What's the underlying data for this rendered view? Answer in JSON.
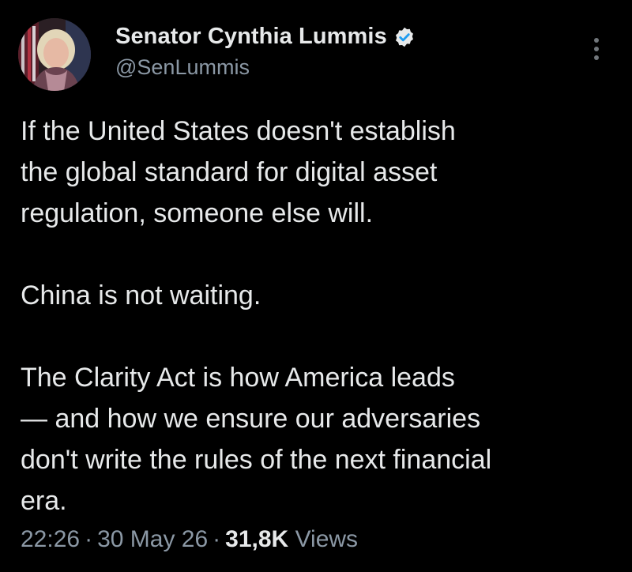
{
  "author": {
    "display_name": "Senator Cynthia Lummis",
    "handle": "@SenLummis",
    "verified_icon": "verified-badge-icon",
    "accent_color": "#1d9bf0"
  },
  "tweet": {
    "paragraphs": [
      {
        "lines": [
          "If the United States doesn't establish",
          "the global standard for digital asset",
          "regulation, someone else will."
        ]
      },
      {
        "lines": [
          "China is not waiting."
        ]
      },
      {
        "lines": [
          "The Clarity Act is how America leads",
          "— and how we ensure our adversaries",
          "don't write the rules of the next financial",
          "era."
        ]
      }
    ]
  },
  "meta": {
    "time": "22:26",
    "separator": "·",
    "date": "30 May 26",
    "views_count": "31,8K",
    "views_label": "Views"
  },
  "colors": {
    "background": "#000000",
    "text_primary": "#e7e9ea",
    "text_secondary": "#8b98a5"
  },
  "icons": {
    "more": "more-options-icon"
  }
}
